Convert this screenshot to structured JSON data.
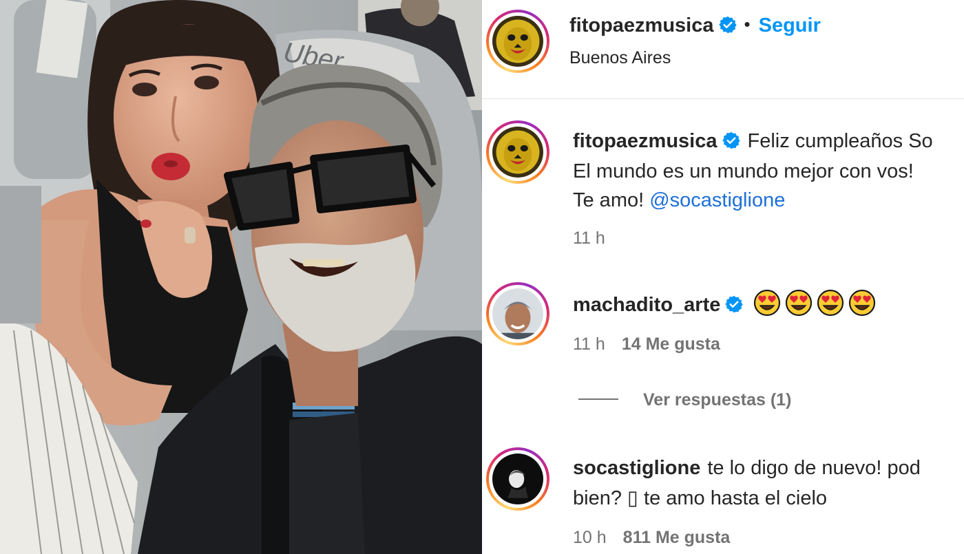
{
  "post": {
    "username": "fitopaezmusica",
    "separator": "•",
    "follow_label": "Seguir",
    "location": "Buenos Aires",
    "photo_logo_text": "Uber"
  },
  "caption": {
    "username": "fitopaezmusica",
    "lines": [
      "Feliz cumpleaños So",
      "El mundo es un mundo mejor con vos!",
      "Te amo!"
    ],
    "mention": "@socastiglione",
    "time": "11 h"
  },
  "comments": [
    {
      "username": "machadito_arte",
      "emoji": [
        "heart-eyes",
        "heart-eyes",
        "heart-eyes",
        "heart-eyes"
      ],
      "time": "11 h",
      "likes": "14 Me gusta",
      "replies_label": "Ver respuestas (1)"
    },
    {
      "username": "socastiglione",
      "line1": "te lo digo de nuevo! pod",
      "line2": "bien? ▯ te amo hasta el cielo",
      "time": "10 h",
      "likes": "811 Me gusta"
    }
  ],
  "colors": {
    "follow": "#0095f6",
    "verified": "#0095f6",
    "meta": "#737373",
    "mention": "#1e6fd9"
  }
}
